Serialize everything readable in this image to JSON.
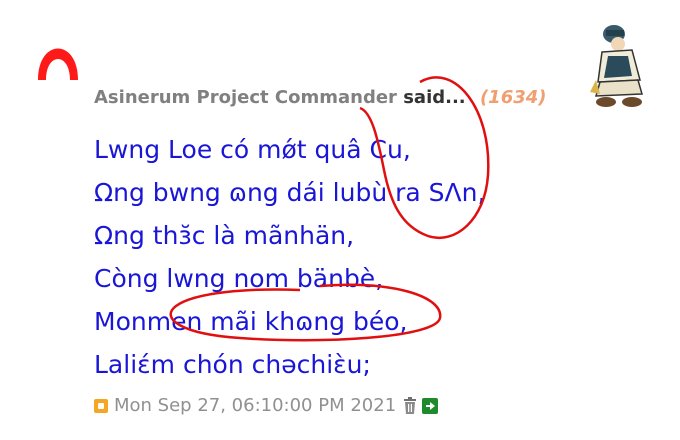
{
  "post": {
    "author": "Asinerum Project Commander",
    "said": "said...",
    "count": "(1634)",
    "lines": [
      "Lwng Loe có mǿt quâ Cu,",
      "Ωng bwng ɷng dái lubù ra SΛn,",
      "Ωng thɜ̆c là mãnhän,",
      "Còng lwng nom bänbè,",
      "Monmen mãi khɷng béo,",
      "Laliɛ́m chón chəchiɛ̀u;"
    ],
    "timestamp": "Mon Sep 27, 06:10:00 PM 2021"
  },
  "icons": {
    "logo": "red-arch-logo",
    "avatar": "soldier-avatar-icon",
    "status": "status-square-icon",
    "delete": "trash-icon",
    "link": "arrow-right-icon"
  },
  "colors": {
    "body_text": "#1a16d6",
    "author": "#808080",
    "count": "#f0a070",
    "annotation": "#e01010"
  }
}
